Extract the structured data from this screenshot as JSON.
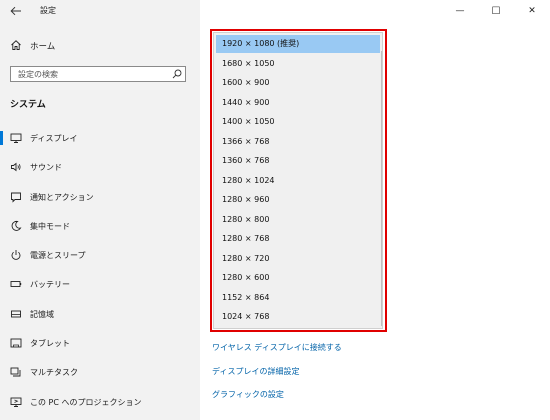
{
  "window": {
    "title": "設定",
    "back_icon": "arrow-left-icon",
    "controls": {
      "minimize": "—",
      "maximize": "☐",
      "close": "✕"
    }
  },
  "sidebar": {
    "home_label": "ホーム",
    "search_placeholder": "設定の検索",
    "section_heading": "システム",
    "items": [
      {
        "label": "ディスプレイ",
        "icon": "monitor-icon",
        "active": true
      },
      {
        "label": "サウンド",
        "icon": "speaker-icon",
        "active": false
      },
      {
        "label": "通知とアクション",
        "icon": "notification-icon",
        "active": false
      },
      {
        "label": "集中モード",
        "icon": "moon-icon",
        "active": false
      },
      {
        "label": "電源とスリープ",
        "icon": "power-icon",
        "active": false
      },
      {
        "label": "バッテリー",
        "icon": "battery-icon",
        "active": false
      },
      {
        "label": "記憶域",
        "icon": "storage-icon",
        "active": false
      },
      {
        "label": "タブレット",
        "icon": "tablet-icon",
        "active": false
      },
      {
        "label": "マルチタスク",
        "icon": "multitask-icon",
        "active": false
      },
      {
        "label": "この PC へのプロジェクション",
        "icon": "projection-icon",
        "active": false
      }
    ]
  },
  "resolution_dropdown": {
    "options": [
      "1920 × 1080 (推奨)",
      "1680 × 1050",
      "1600 × 900",
      "1440 × 900",
      "1400 × 1050",
      "1366 × 768",
      "1360 × 768",
      "1280 × 1024",
      "1280 × 960",
      "1280 × 800",
      "1280 × 768",
      "1280 × 720",
      "1280 × 600",
      "1152 × 864",
      "1024 × 768"
    ],
    "selected": "1920 × 1080 (推奨)",
    "highlight_color": "#e00000",
    "selected_color": "#99c9f3"
  },
  "links": {
    "wireless_display": "ワイヤレス ディスプレイに接続する",
    "advanced_display": "ディスプレイの詳細設定",
    "graphics": "グラフィックの設定"
  },
  "colors": {
    "accent": "#0078d7",
    "link": "#0062a8",
    "sidebar_bg": "#f2f2f2"
  }
}
